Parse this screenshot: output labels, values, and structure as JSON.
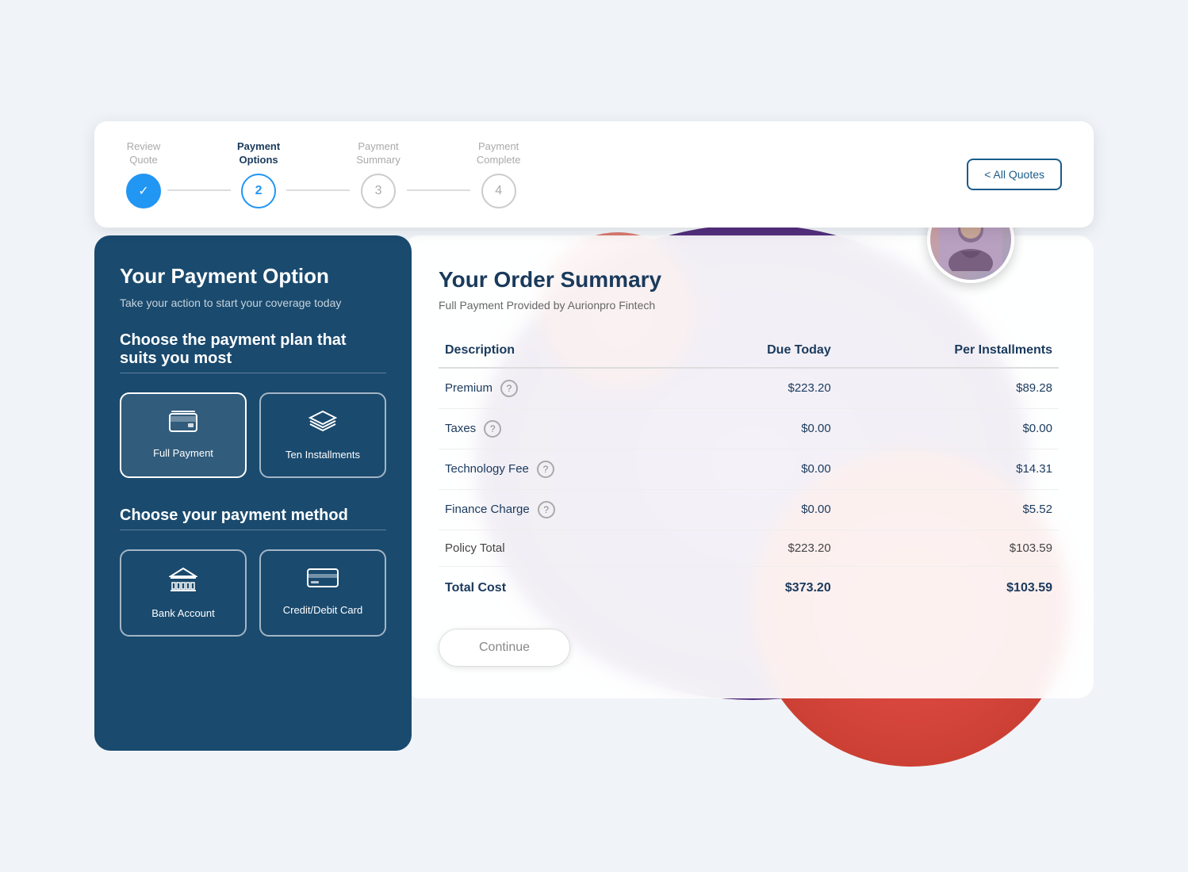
{
  "stepper": {
    "steps": [
      {
        "label": "Review\nQuote",
        "number": "✓",
        "state": "completed"
      },
      {
        "label": "Payment\nOptions",
        "number": "2",
        "state": "active"
      },
      {
        "label": "Payment\nSummary",
        "number": "3",
        "state": "inactive"
      },
      {
        "label": "Payment\nComplete",
        "number": "4",
        "state": "inactive"
      }
    ],
    "all_quotes_label": "< All Quotes"
  },
  "left_panel": {
    "title": "Your Payment Option",
    "subtitle": "Take your action to start your coverage today",
    "plan_heading": "Choose the payment plan that suits you most",
    "plans": [
      {
        "label": "Full Payment",
        "icon": "wallet"
      },
      {
        "label": "Ten Installments",
        "icon": "layers"
      }
    ],
    "method_heading": "Choose your payment method",
    "methods": [
      {
        "label": "Bank Account",
        "icon": "bank"
      },
      {
        "label": "Credit/Debit Card",
        "icon": "card"
      }
    ]
  },
  "right_panel": {
    "title": "Your Order Summary",
    "provider": "Full Payment Provided by Aurionpro Fintech",
    "table": {
      "headers": [
        "Description",
        "Due Today",
        "Per Installments"
      ],
      "rows": [
        {
          "name": "Premium",
          "has_info": true,
          "due_today": "$223.20",
          "per_installment": "$89.28"
        },
        {
          "name": "Taxes",
          "has_info": true,
          "due_today": "$0.00",
          "per_installment": "$0.00"
        },
        {
          "name": "Technology Fee",
          "has_info": true,
          "due_today": "$0.00",
          "per_installment": "$14.31"
        },
        {
          "name": "Finance Charge",
          "has_info": true,
          "due_today": "$0.00",
          "per_installment": "$5.52"
        },
        {
          "name": "Policy Total",
          "has_info": false,
          "due_today": "$223.20",
          "per_installment": "$103.59"
        },
        {
          "name": "Total Cost",
          "has_info": false,
          "due_today": "$373.20",
          "per_installment": "$103.59",
          "is_total": true
        }
      ]
    },
    "continue_label": "Continue"
  }
}
